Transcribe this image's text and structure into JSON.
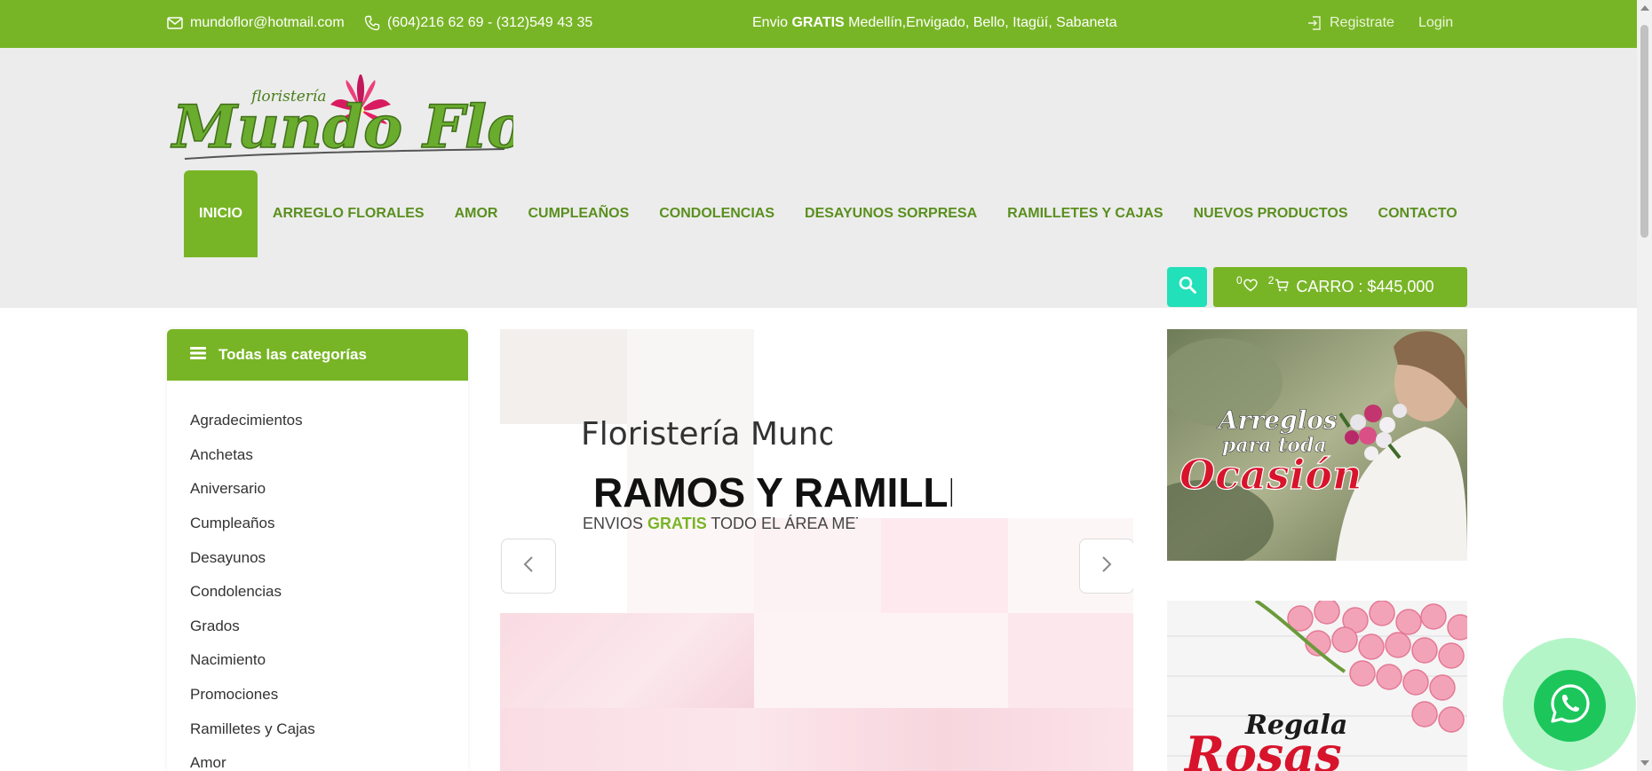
{
  "topbar": {
    "email": "mundoflor@hotmail.com",
    "phone": "(604)216 62 69 - (312)549 43 35",
    "shipping_prefix": "Envio ",
    "shipping_bold": "GRATIS",
    "shipping_suffix": " Medellín,Envigado, Bello, Itagüí, Sabaneta",
    "register": "Registrate",
    "login": "Login",
    "bg_color": "#78b526"
  },
  "logo": {
    "small_text": "floristería",
    "main_text": "Mundo Flor"
  },
  "nav": {
    "items": [
      {
        "label": "INICIO"
      },
      {
        "label": "ARREGLO FLORALES"
      },
      {
        "label": "AMOR"
      },
      {
        "label": "CUMPLEAÑOS"
      },
      {
        "label": "CONDOLENCIAS"
      },
      {
        "label": "DESAYUNOS SORPRESA"
      },
      {
        "label": "RAMILLETES Y CAJAS"
      },
      {
        "label": "NUEVOS PRODUCTOS"
      },
      {
        "label": "CONTACTO"
      }
    ]
  },
  "cart": {
    "wishlist_count": "0",
    "cart_count": "2",
    "label": "CARRO : $445,000"
  },
  "sidebar": {
    "title": "Todas las categorías",
    "categories": [
      "Agradecimientos",
      "Anchetas",
      "Aniversario",
      "Cumpleaños",
      "Desayunos",
      "Condolencias",
      "Grados",
      "Nacimiento",
      "Promociones",
      "Ramilletes y Cajas",
      "Amor"
    ]
  },
  "slider": {
    "subtitle": "Floristería Mundo Flor",
    "title": "RAMOS Y RAMILLETES",
    "line_prefix": "ENVIOS ",
    "line_bold": "GRATIS",
    "line_suffix": " TODO EL ÁREA METROPOLITANA"
  },
  "promos": {
    "promo1_line1": "Arreglos",
    "promo1_line2": "para toda",
    "promo1_line3": "Ocasión",
    "promo2_line1": "Regala",
    "promo2_line2": "Rosas"
  },
  "colors": {
    "accent_green": "#78b526",
    "search_teal": "#22e0b9",
    "whatsapp": "#1cc65b"
  }
}
